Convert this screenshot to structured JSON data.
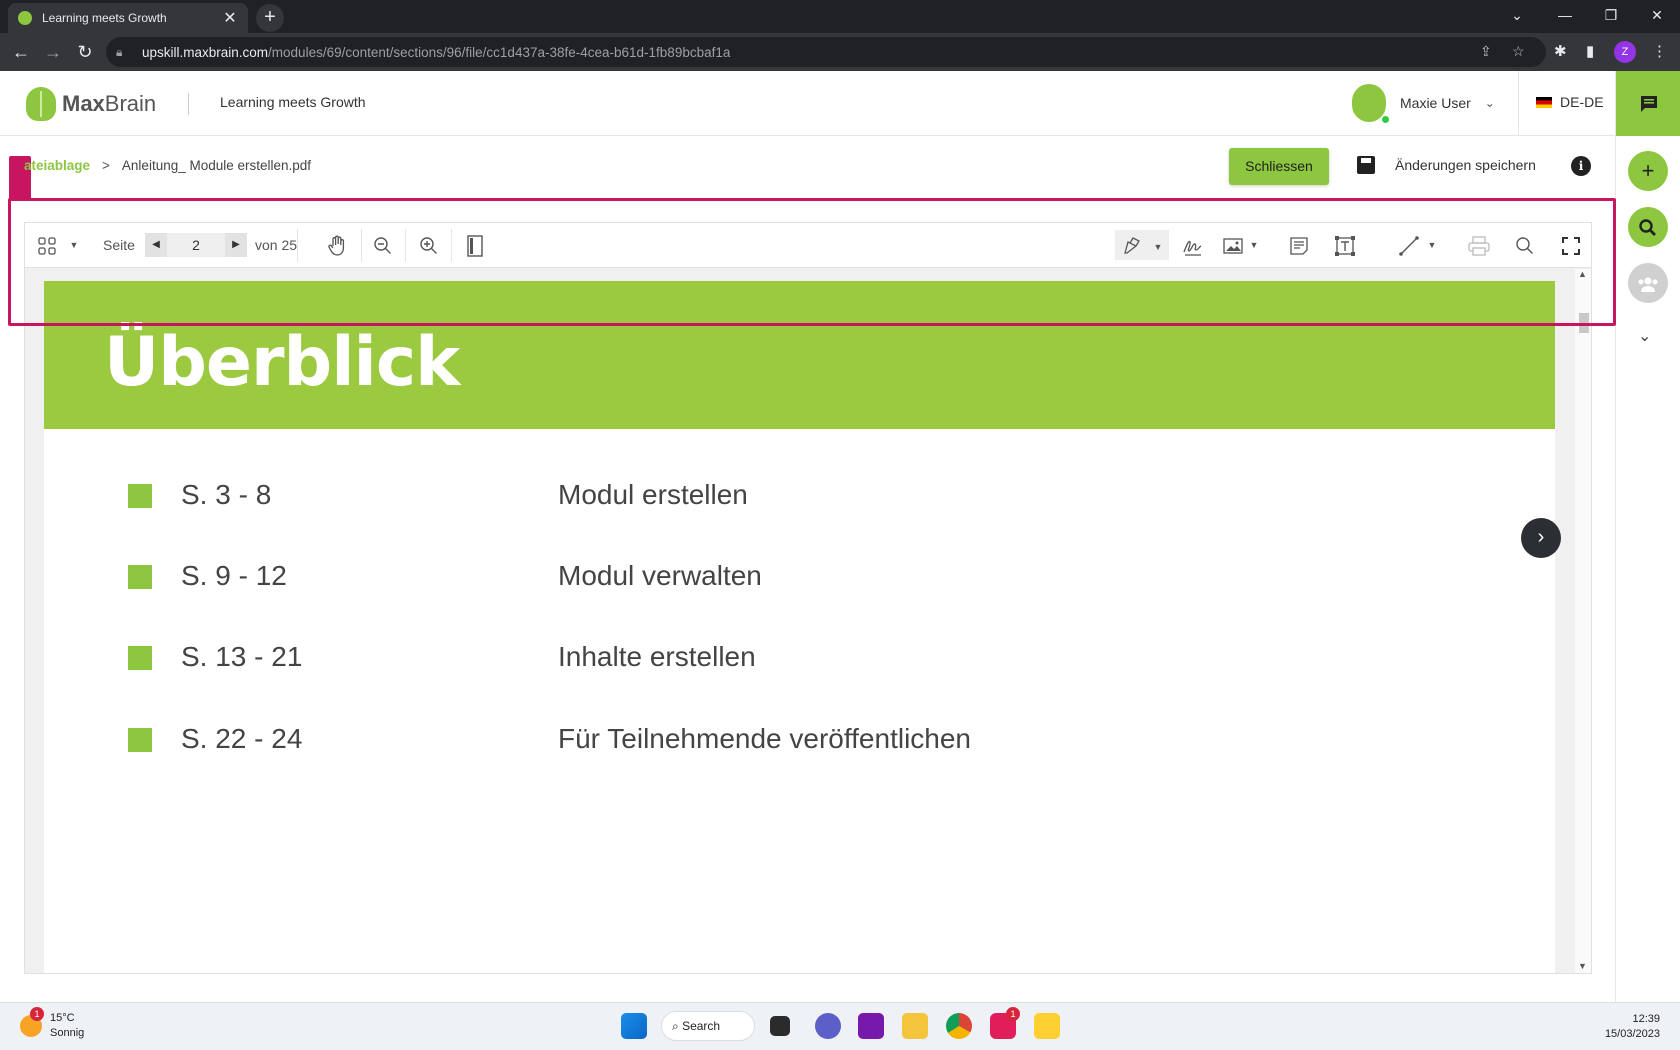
{
  "browser": {
    "tab_title": "Learning meets Growth",
    "tab_close": "✕",
    "new_tab": "+",
    "url_host": "upskill.maxbrain.com",
    "url_path": "/modules/69/content/sections/96/file/cc1d437a-38fe-4cea-b61d-1fb89bcbaf1a",
    "profile_initial": "Z"
  },
  "header": {
    "logo_bold": "Max",
    "logo_light": "Brain",
    "app_title": "Learning meets Growth",
    "user_name": "Maxie User",
    "language": "DE-DE"
  },
  "breadcrumb": {
    "root": "ateiablage",
    "separator": ">",
    "current": "Anleitung_ Module erstellen.pdf"
  },
  "actions": {
    "close_label": "Schliessen",
    "save_label": "Änderungen speichern",
    "info_label": "i"
  },
  "viewer_toolbar": {
    "page_label": "Seite",
    "page_number": "2",
    "page_total": "von 25"
  },
  "pdf_page": {
    "heading": "Überblick",
    "rows": [
      {
        "pages": "S. 3 - 8",
        "title": "Modul erstellen"
      },
      {
        "pages": "S. 9 - 12",
        "title": "Modul verwalten"
      },
      {
        "pages": "S. 13 - 21",
        "title": "Inhalte erstellen"
      },
      {
        "pages": "S. 22 - 24",
        "title": "Für Teilnehmende veröffentlichen"
      }
    ]
  },
  "taskbar": {
    "temperature": "15°C",
    "weather": "Sonnig",
    "weather_badge": "1",
    "search_label": "Search",
    "slack_badge": "1",
    "time": "12:39",
    "date": "15/03/2023"
  },
  "colors": {
    "brand_green": "#8dc63f",
    "highlight": "#c8155f"
  },
  "icons": [
    "chat-icon",
    "plus-icon",
    "search-icon",
    "people-icon",
    "hand-icon",
    "zoom-out-icon",
    "zoom-in-icon",
    "pen-icon",
    "signature-icon",
    "image-icon",
    "note-icon",
    "text-box-icon",
    "line-icon",
    "print-icon",
    "fullscreen-icon"
  ]
}
